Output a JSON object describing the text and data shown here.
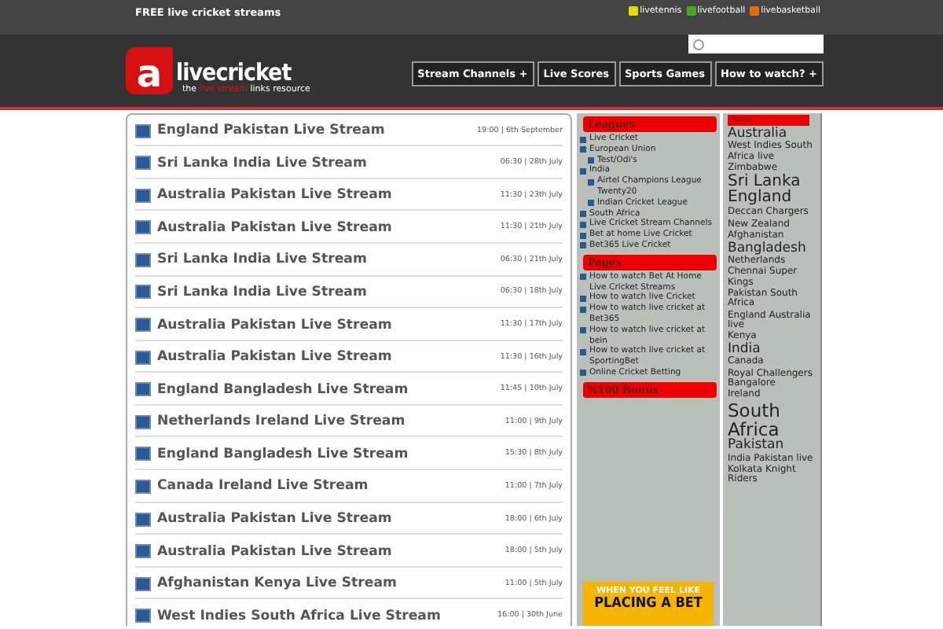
{
  "top_bar": {
    "tagline": "FREE live cricket streams",
    "links": [
      {
        "label": "livetennis",
        "color": "#e8d800"
      },
      {
        "label": "livefootball",
        "color": "#44aa22"
      },
      {
        "label": "livebasketball",
        "color": "#e86a10"
      }
    ]
  },
  "header": {
    "logo": {
      "letter": "a",
      "name": "livecricket",
      "tagline_before": "the",
      "tagline_highlight": "live stream",
      "tagline_after": "links resource"
    },
    "nav": [
      "Stream Channels +",
      "Live Scores",
      "Sports Games",
      "How to watch? +"
    ]
  },
  "streams": [
    {
      "title": "England Pakistan Live Stream",
      "time": "19:00 | 6th September"
    },
    {
      "title": "Sri Lanka India Live Stream",
      "time": "06:30 | 28th July"
    },
    {
      "title": "Australia Pakistan Live Stream",
      "time": "11:30 | 23th July"
    },
    {
      "title": "Australia Pakistan Live Stream",
      "time": "11:30 | 21th July"
    },
    {
      "title": "Sri Lanka India Live Stream",
      "time": "06:30 | 21th July"
    },
    {
      "title": "Sri Lanka India Live Stream",
      "time": "06:30 | 18th July"
    },
    {
      "title": "Australia Pakistan Live Stream",
      "time": "11:30 | 17th July"
    },
    {
      "title": "Australia Pakistan Live Stream",
      "time": "11:30 | 16th July"
    },
    {
      "title": "England Bangladesh Live Stream",
      "time": "11:45 | 10th July"
    },
    {
      "title": "Netherlands Ireland Live Stream",
      "time": "11:00 | 9th July"
    },
    {
      "title": "England Bangladesh Live Stream",
      "time": "15:30 | 8th July"
    },
    {
      "title": "Canada Ireland Live Stream",
      "time": "11:00 | 7th July"
    },
    {
      "title": "Australia Pakistan Live Stream",
      "time": "18:00 | 6th July"
    },
    {
      "title": "Australia Pakistan Live Stream",
      "time": "18:00 | 5th July"
    },
    {
      "title": "Afghanistan Kenya Live Stream",
      "time": "11:00 | 5th July"
    },
    {
      "title": "West Indies South Africa Live Stream",
      "time": "16:00 | 30th June"
    }
  ],
  "sidebar": {
    "leagues": {
      "title": "Leagues",
      "items": [
        {
          "label": "Live Cricket"
        },
        {
          "label": "European Union",
          "children": [
            {
              "label": "Test/Odi's"
            }
          ]
        },
        {
          "label": "India",
          "children": [
            {
              "label": "Airtel Champions League Twenty20"
            },
            {
              "label": "Indian Cricket League"
            }
          ]
        },
        {
          "label": "South Africa"
        },
        {
          "label": "Live Cricket Stream Channels"
        },
        {
          "label": "Bet at home Live Cricket"
        },
        {
          "label": "Bet365 Live Cricket"
        }
      ]
    },
    "pages": {
      "title": "Pages",
      "items": [
        "How to watch Bet At Home Live Cricket Streams",
        "How to watch live Cricket",
        "How to watch live cricket at Bet365",
        "How to watch live cricket at bein",
        "How to watch live cricket at SportingBet",
        "Online Cricket Betting"
      ]
    },
    "bonus": {
      "title": "%100 Bonus",
      "ad_line1": "WHEN YOU FEEL LIKE",
      "ad_line2": "PLACING A BET"
    }
  },
  "teams": {
    "title": "Teams",
    "tags": [
      {
        "label": "Australia",
        "kind": "large"
      },
      {
        "label": "West Indies South Africa live",
        "kind": "small"
      },
      {
        "label": "Zimbabwe",
        "kind": "small"
      },
      {
        "label": "Sri Lanka",
        "kind": "xlarge"
      },
      {
        "label": "England",
        "kind": "xlarge"
      },
      {
        "label": "Deccan Chargers",
        "kind": "small"
      },
      {
        "label": "New Zealand",
        "kind": "small"
      },
      {
        "label": "Afghanistan",
        "kind": "small"
      },
      {
        "label": "Bangladesh",
        "kind": "large"
      },
      {
        "label": "Netherlands",
        "kind": "small"
      },
      {
        "label": "Chennai Super Kings",
        "kind": "small"
      },
      {
        "label": "Pakistan South Africa",
        "kind": "small"
      },
      {
        "label": "England Australia live",
        "kind": "small"
      },
      {
        "label": "Kenya",
        "kind": "small"
      },
      {
        "label": "India",
        "kind": "large"
      },
      {
        "label": "Canada",
        "kind": "small"
      },
      {
        "label": "Royal Challengers Bangalore",
        "kind": "small"
      },
      {
        "label": "Ireland",
        "kind": "small"
      },
      {
        "label": "South Africa",
        "kind": "xxlarge"
      },
      {
        "label": "Pakistan",
        "kind": "large"
      },
      {
        "label": "India Pakistan live",
        "kind": "small"
      },
      {
        "label": "Kolkata Knight Riders",
        "kind": "small"
      }
    ]
  }
}
